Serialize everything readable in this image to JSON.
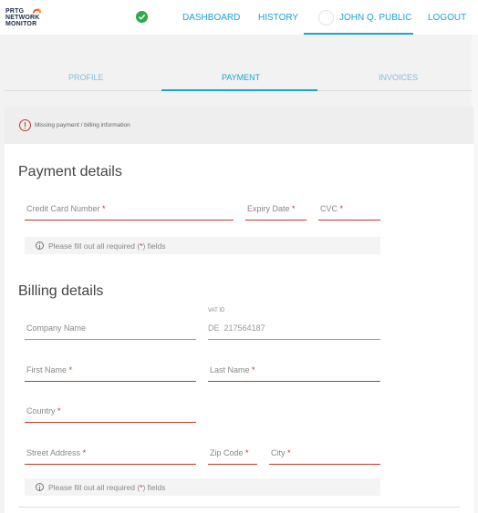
{
  "brand": {
    "logo_line1": "PRTG",
    "logo_line2": "NETWORK",
    "logo_line3": "MONITOR"
  },
  "nav": {
    "dashboard": "DASHBOARD",
    "history": "HISTORY",
    "user": "JOHN Q. PUBLIC",
    "logout": "LOGOUT"
  },
  "tabs": {
    "profile": "PROFILE",
    "payment": "PAYMENT",
    "invoices": "INVOICES"
  },
  "alert": {
    "text": "Missing payment / billing information"
  },
  "payment": {
    "title": "Payment details",
    "card_number_label": "Credit Card Number",
    "expiry_label": "Expiry Date",
    "cvc_label": "CVC",
    "hint_prefix": "Please fill out all required (",
    "hint_star": "*",
    "hint_suffix": ") fields"
  },
  "billing": {
    "title": "Billing details",
    "company_label": "Company Name",
    "vat_label": "VAT ID",
    "vat_prefix": "DE",
    "vat_value": "217564187",
    "first_name_label": "First Name",
    "last_name_label": "Last Name",
    "country_label": "Country",
    "street_label": "Street Address",
    "zip_label": "Zip Code",
    "city_label": "City",
    "hint_prefix": "Please fill out all required (",
    "hint_star": "*",
    "hint_suffix": ") fields"
  },
  "required_marker": "*",
  "colors": {
    "accent": "#1aa3d9",
    "error": "#c0392b",
    "success": "#2eaa4a"
  }
}
